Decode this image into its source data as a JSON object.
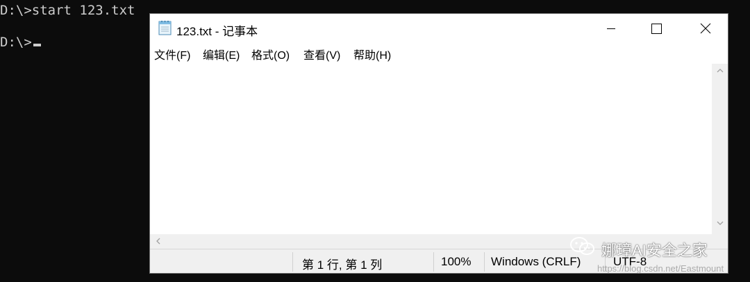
{
  "console": {
    "line1": "D:\\>start 123.txt",
    "line2": "D:\\>"
  },
  "notepad": {
    "title": "123.txt - 记事本",
    "menu": [
      "文件(F)",
      "编辑(E)",
      "格式(O)",
      "查看(V)",
      "帮助(H)"
    ],
    "content": "",
    "status": {
      "position": "第 1 行, 第 1 列",
      "zoom": "100%",
      "line_ending": "Windows (CRLF)",
      "encoding": "UTF-8"
    },
    "icons": {
      "app": "notepad-icon",
      "minimize": "minimize-icon",
      "maximize": "maximize-icon",
      "close": "close-icon"
    }
  },
  "watermark": {
    "text": "娜璋AI安全之家",
    "url": "https://blog.csdn.net/Eastmount"
  },
  "colors": {
    "console_bg": "#0c0c0c",
    "console_fg": "#cccccc",
    "window_bg": "#ffffff",
    "chrome_bg": "#f0f0f0"
  }
}
